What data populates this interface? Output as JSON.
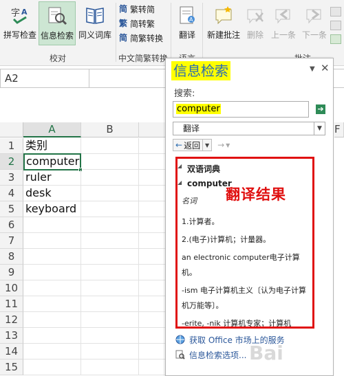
{
  "ribbon": {
    "buttons": {
      "spell": "拼写检查",
      "research": "信息检索",
      "thesaurus": "同义词库",
      "translate": "翻译",
      "new_comment": "新建批注",
      "delete": "删除",
      "prev": "上一条",
      "next": "下一条"
    },
    "small_buttons": {
      "trad_to_simp": "繁转简",
      "simp_to_trad": "简转繁",
      "simp_trad_convert": "简繁转换"
    },
    "group_labels": {
      "proofing": "校对",
      "chinese_conversion": "中文简繁转换",
      "language": "语言",
      "comments": "批注"
    }
  },
  "namebox": {
    "value": "A2"
  },
  "grid": {
    "columns": [
      "A",
      "B",
      "F"
    ],
    "rows": [
      "1",
      "2",
      "3",
      "4",
      "5",
      "6",
      "7",
      "8",
      "9",
      "10",
      "11",
      "12",
      "13",
      "14",
      "15"
    ],
    "cells_a": [
      "类别",
      "computer",
      "ruler",
      "desk",
      "keyboard"
    ]
  },
  "pane": {
    "title": "信息检索",
    "search_label": "搜索:",
    "search_value": "computer",
    "source": "翻译",
    "back": "返回",
    "results": {
      "section": "双语词典",
      "word": "computer",
      "pos": "名词",
      "items": [
        "1.计算者。",
        "2.(电子)计算机；计量器。",
        "an electronic computer电子计算机。",
        "-ism 电子计算机主义〔认为电子计算机万能等〕。",
        "-erite, -nik 计算机专家；计算机"
      ]
    },
    "annotation": "翻译结果",
    "links": {
      "market": "获取 Office 市场上的服务",
      "options": "信息检索选项..."
    }
  },
  "watermark": "Bai"
}
